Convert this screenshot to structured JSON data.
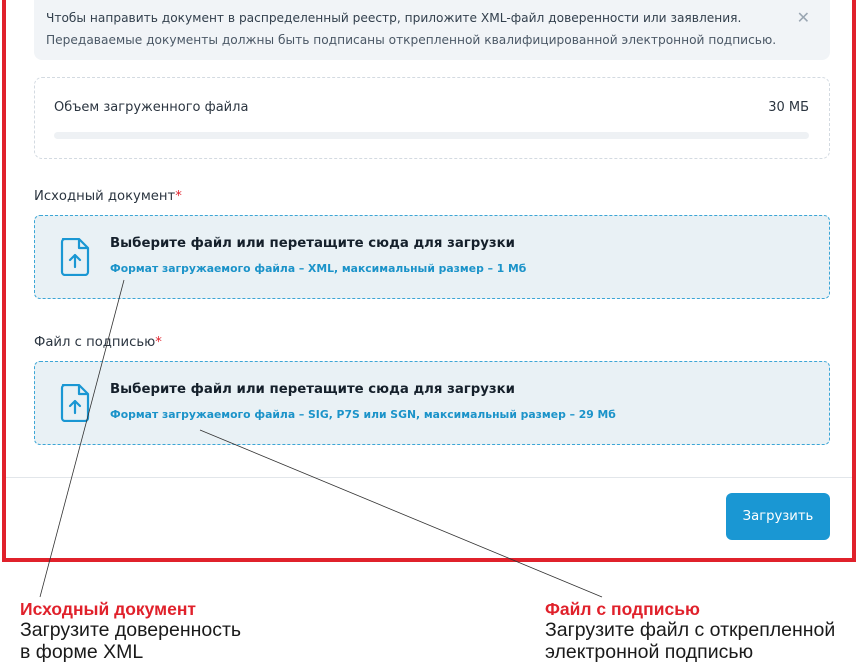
{
  "notice": {
    "line1": "Чтобы направить документ в распределенный реестр, приложите XML-файл доверенности или заявления.",
    "line2": "Передаваемые документы должны быть подписаны открепленной квалифицированной электронной подписью.",
    "close_icon": "close-icon"
  },
  "file_size": {
    "label": "Объем загруженного файла",
    "value": "30 МБ",
    "progress_fraction": 0
  },
  "source_document": {
    "label": "Исходный документ",
    "required_mark": "*",
    "drop_text": "Выберите файл или перетащите сюда для загрузки",
    "format_hint": "Формат загружаемого файла – XML, максимальный размер – 1 Мб",
    "icon": "file-upload-icon"
  },
  "signature_file": {
    "label": "Файл с подписью",
    "required_mark": "*",
    "drop_text": "Выберите файл или перетащите сюда для загрузки",
    "format_hint": "Формат загружаемого файла – SIG, P7S или SGN, максимальный размер – 29 Мб",
    "icon": "file-upload-icon"
  },
  "upload_button": "Загрузить",
  "callouts": {
    "left": {
      "title": "Исходный документ",
      "line1": "Загрузите доверенность",
      "line2": "в форме XML"
    },
    "right": {
      "title": "Файл с подписью",
      "line1": "Загрузите файл с открепленной",
      "line2": "электронной подписью"
    }
  },
  "colors": {
    "accent": "#1a97d3",
    "highlight_frame": "#e0212b",
    "drop_background": "#e9f1f5"
  }
}
